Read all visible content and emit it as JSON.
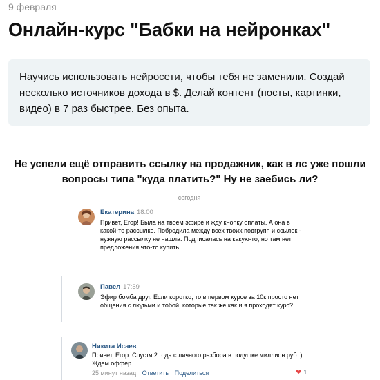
{
  "post": {
    "date": "9 февраля",
    "title": "Онлайн-курс \"Бабки на нейронках\"",
    "callout": "Научись использовать нейросети, чтобы тебя не заменили. Создай несколько источников дохода в $. Делай контент (посты, картинки, видео) в 7 раз быстрее. Без опыта.",
    "lead_line1": "Не успели ещё отправить ссылку на продажник, как в лс уже пошли",
    "lead_line2": "вопросы типа \"куда платить?\" Ну не заебись ли?"
  },
  "screenshot": {
    "day_label": "сегодня",
    "messages": [
      {
        "author": "Екатерина",
        "time": "18:00",
        "text": "Привет, Егор! Была на твоем эфире и жду кнопку оплаты. А она в какой-то рассылке. Побродила между всех твоих подгрупп и ссылок - нужную рассылку не нашла. Подписалась на какую-то, но там нет предложения что-то купить",
        "avatar_color": "#a0654a"
      },
      {
        "author": "Павел",
        "time": "17:59",
        "text": "Эфир бомба друг. Если коротко, то в первом курсе за 10к просто нет общения с людьми и тобой, которые так же как и я проходят курс?",
        "avatar_color": "#7b7f76"
      }
    ],
    "comment": {
      "author": "Никита Исаев",
      "text": "Привет, Егор. Спустя 2 года с личного разбора в подушке миллион руб. ) Ждем оффер",
      "time": "25 минут назад",
      "reply_label": "Ответить",
      "share_label": "Поделиться",
      "likes": "1",
      "avatar_color": "#5c6a72"
    }
  }
}
